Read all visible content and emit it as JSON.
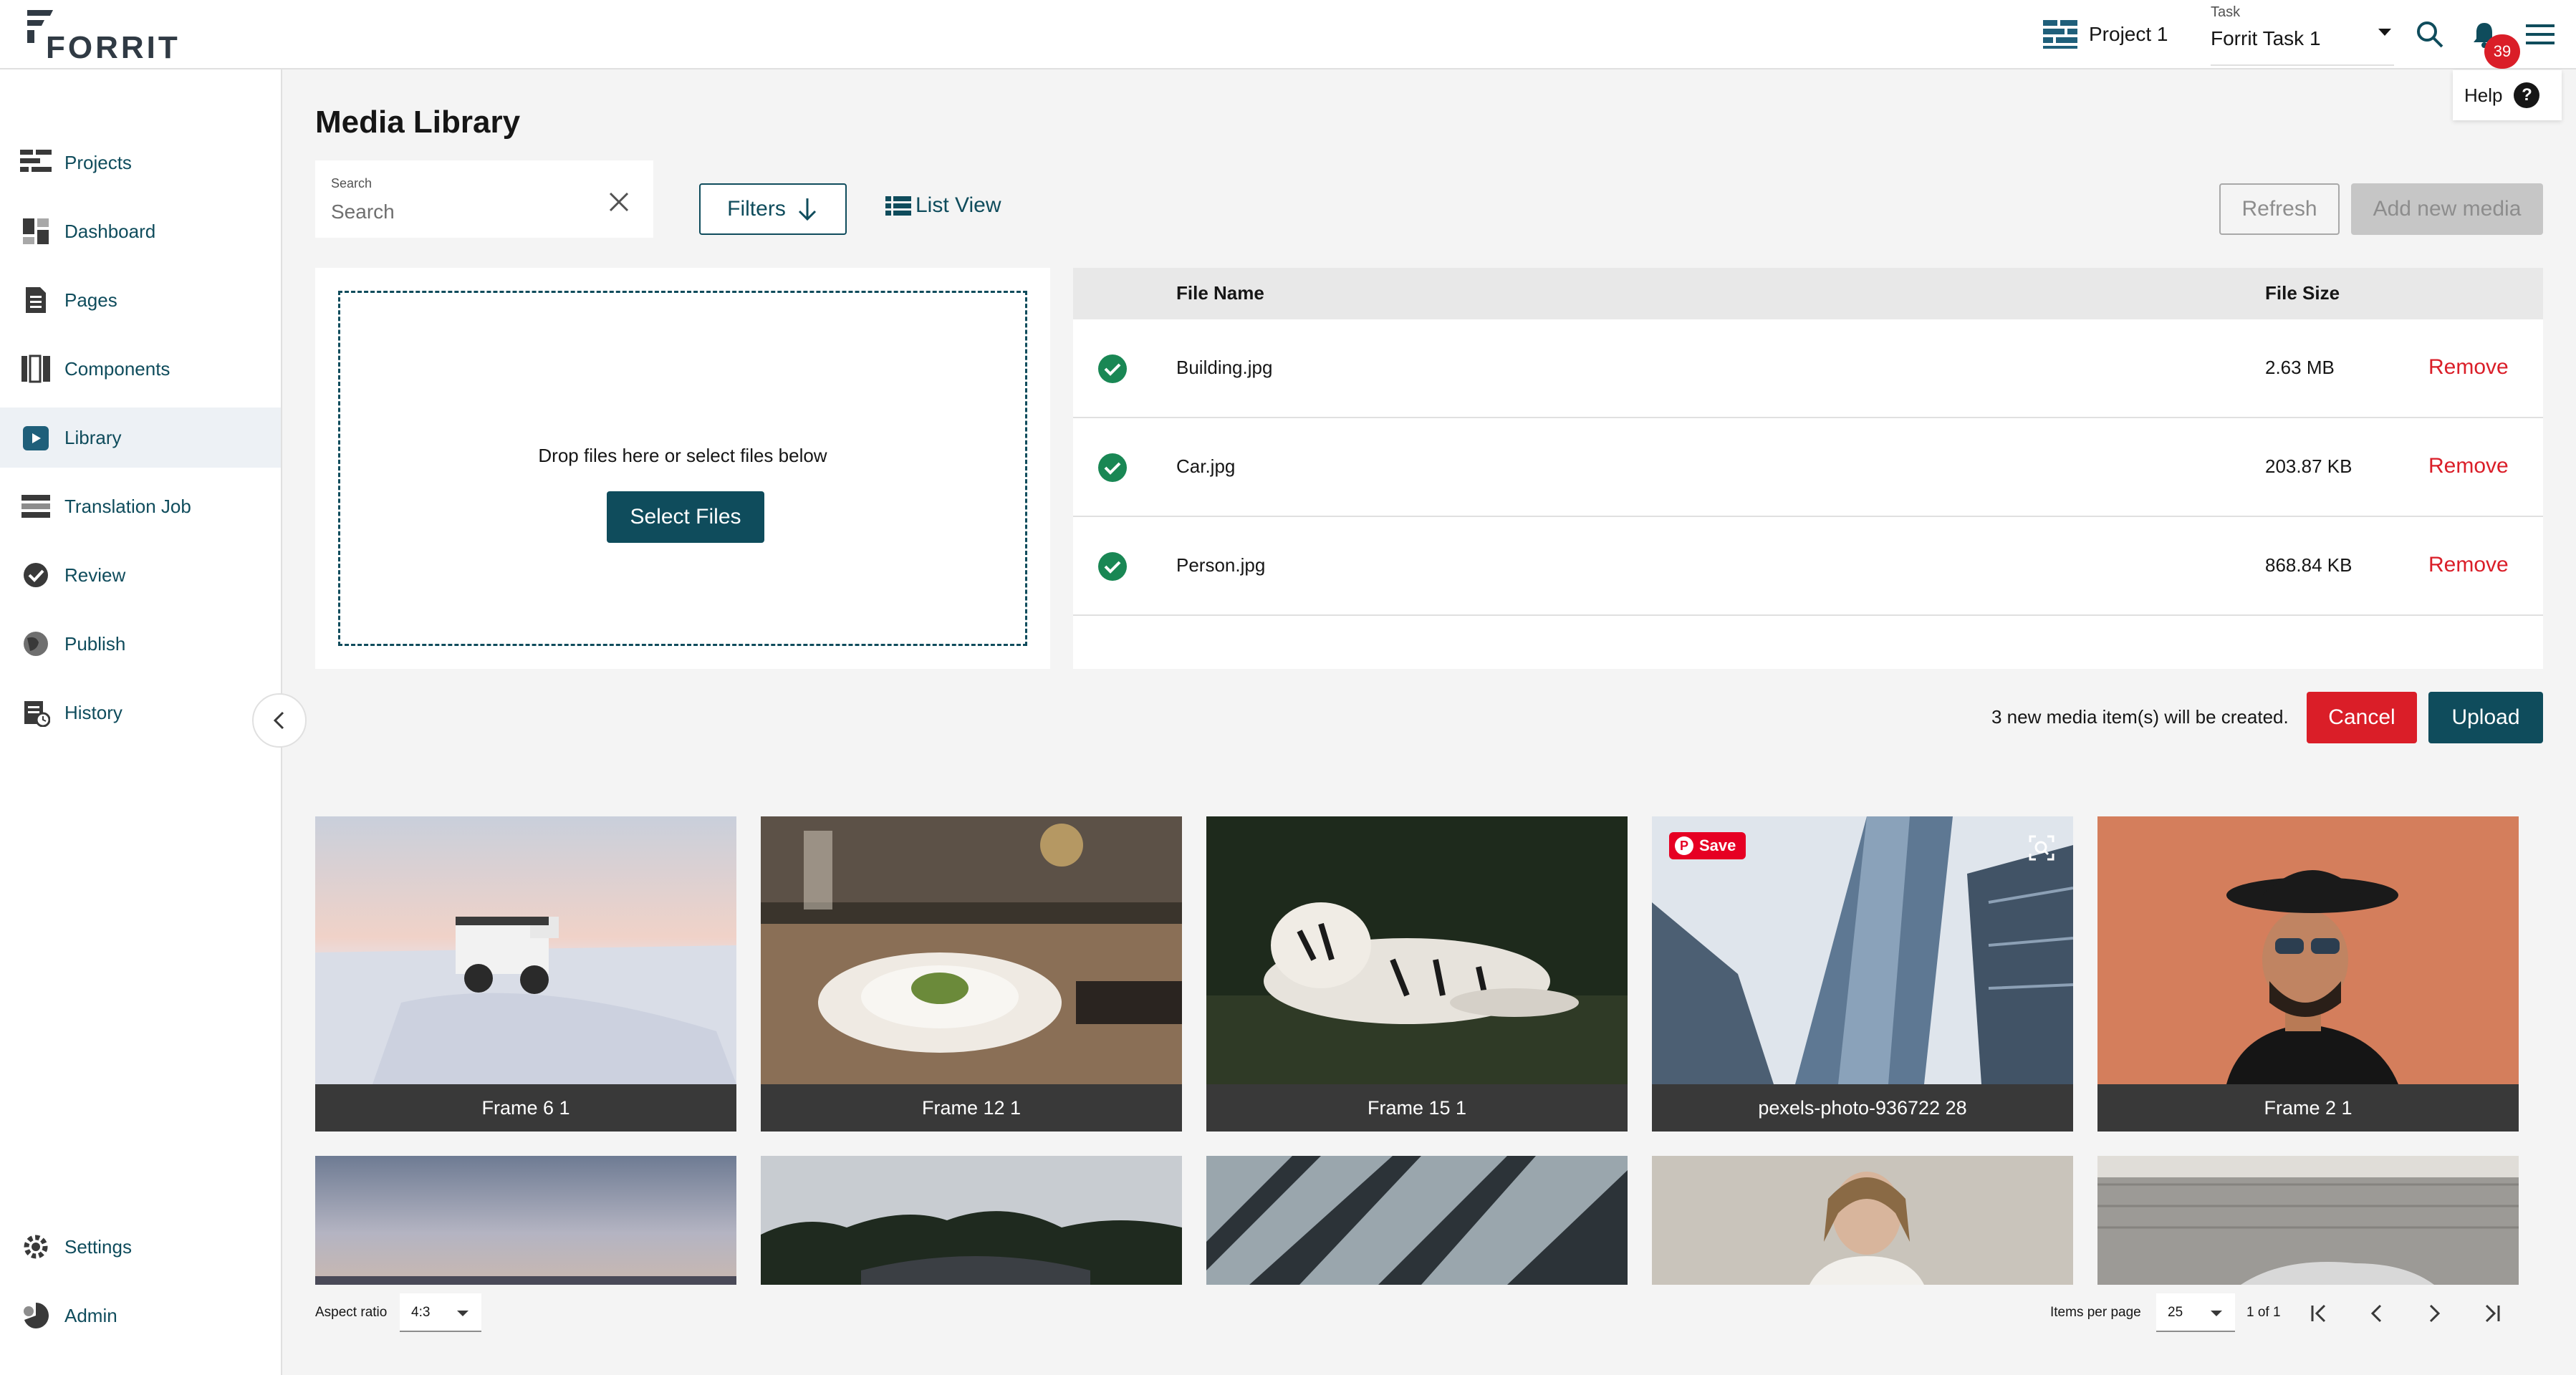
{
  "app": {
    "logo_text": "FORRIT"
  },
  "header": {
    "project_label": "Project 1",
    "task_caption": "Task",
    "task_value": "Forrit Task 1",
    "notification_count": "39",
    "help_label": "Help",
    "help_glyph": "?"
  },
  "sidebar": {
    "items": [
      {
        "label": "Projects",
        "icon": "projects-icon"
      },
      {
        "label": "Dashboard",
        "icon": "dashboard-icon"
      },
      {
        "label": "Pages",
        "icon": "pages-icon"
      },
      {
        "label": "Components",
        "icon": "components-icon"
      },
      {
        "label": "Library",
        "icon": "library-icon",
        "active": true
      },
      {
        "label": "Translation Job",
        "icon": "translation-icon"
      },
      {
        "label": "Review",
        "icon": "review-icon"
      },
      {
        "label": "Publish",
        "icon": "publish-icon"
      },
      {
        "label": "History",
        "icon": "history-icon"
      }
    ],
    "bottom_items": [
      {
        "label": "Settings",
        "icon": "settings-icon"
      },
      {
        "label": "Admin",
        "icon": "admin-icon"
      }
    ]
  },
  "main": {
    "title": "Media Library",
    "search": {
      "caption": "Search",
      "placeholder": "Search",
      "value": ""
    },
    "filters_label": "Filters",
    "list_view_label": "List View",
    "refresh_label": "Refresh",
    "add_media_label": "Add new media"
  },
  "upload": {
    "drop_hint": "Drop files here or select files below",
    "select_label": "Select Files",
    "columns": {
      "file_name": "File Name",
      "file_size": "File Size"
    },
    "files": [
      {
        "name": "Building.jpg",
        "size": "2.63 MB",
        "action": "Remove"
      },
      {
        "name": "Car.jpg",
        "size": "203.87 KB",
        "action": "Remove"
      },
      {
        "name": "Person.jpg",
        "size": "868.84 KB",
        "action": "Remove"
      }
    ],
    "note": "3 new media item(s) will be created.",
    "cancel_label": "Cancel",
    "upload_label": "Upload"
  },
  "gallery": {
    "tiles": [
      {
        "caption": "Frame 6 1"
      },
      {
        "caption": "Frame 12 1"
      },
      {
        "caption": "Frame 15 1"
      },
      {
        "caption": "pexels-photo-936722 28"
      },
      {
        "caption": "Frame 2 1"
      }
    ],
    "pin_save_label": "Save",
    "pin_glyph": "P"
  },
  "footer": {
    "aspect_label": "Aspect ratio",
    "aspect_value": "4:3",
    "items_per_page_label": "Items per page",
    "items_per_page_value": "25",
    "page_of": "1 of 1"
  },
  "colors": {
    "brand_teal": "#0f4c5c",
    "danger_red": "#da1e28",
    "success_green": "#198754"
  }
}
